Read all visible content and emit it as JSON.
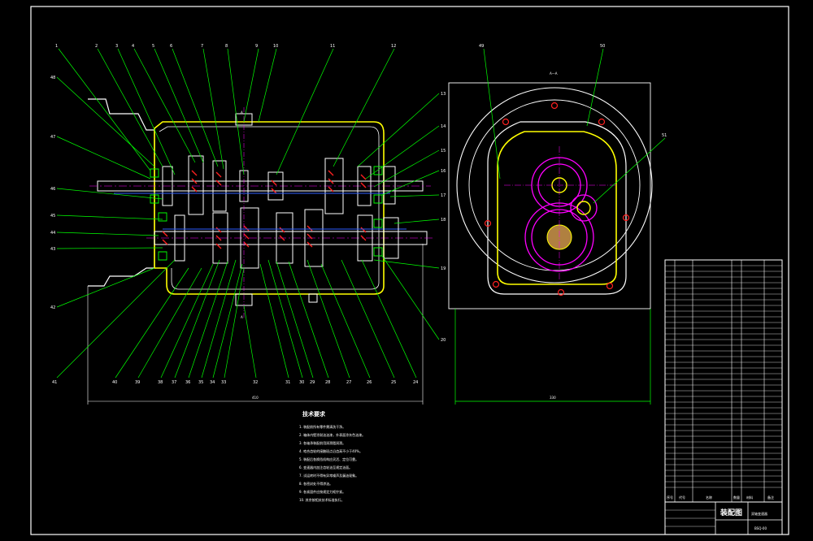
{
  "drawing": {
    "section_label": "A—A",
    "section_marker": "A",
    "dim_left": "410",
    "dim_right": "330",
    "dim_height": "250"
  },
  "balloons_top": [
    "1",
    "2",
    "3",
    "4",
    "5",
    "6",
    "7",
    "8",
    "9",
    "10",
    "11",
    "12"
  ],
  "balloons_right": [
    "13",
    "14",
    "15",
    "16",
    "17",
    "18",
    "19",
    "20"
  ],
  "balloons_left": [
    "48",
    "47",
    "46",
    "45",
    "44",
    "43",
    "42"
  ],
  "balloons_bottom": [
    "41",
    "40",
    "39",
    "38",
    "37",
    "36",
    "35",
    "34",
    "33",
    "32",
    "31",
    "30",
    "29",
    "28",
    "27",
    "26",
    "25",
    "24",
    "23",
    "22",
    "21"
  ],
  "balloons_section": [
    "49",
    "50",
    "51"
  ],
  "notes": {
    "title": "技术要求",
    "lines": [
      "1. 装配前所有零件需清洗干净。",
      "2. 箱体内壁涂耐油油漆，外表面涂灰色油漆。",
      "3. 各轴承装配前用润滑脂润滑。",
      "4. 啮合齿轮的接触斑点沿齿高不小于40%。",
      "5. 装配后各换挡机构应灵活、定位可靠。",
      "6. 变速器内加注齿轮油至规定油面。",
      "7. 试运转时不得有异常噪声及漏油现象。",
      "8. 各密封处不得渗油。",
      "9. 各紧固件应按规定力矩拧紧。",
      "10. 其余按相关技术标准执行。"
    ]
  },
  "title_block": {
    "drawing_name": "装配图",
    "product_name": "双轴变速器",
    "drawing_no": "BSQ-00",
    "col_no": "序号",
    "col_code": "代号",
    "col_name": "名称",
    "col_qty": "数量",
    "col_material": "材料",
    "col_note": "备注"
  }
}
